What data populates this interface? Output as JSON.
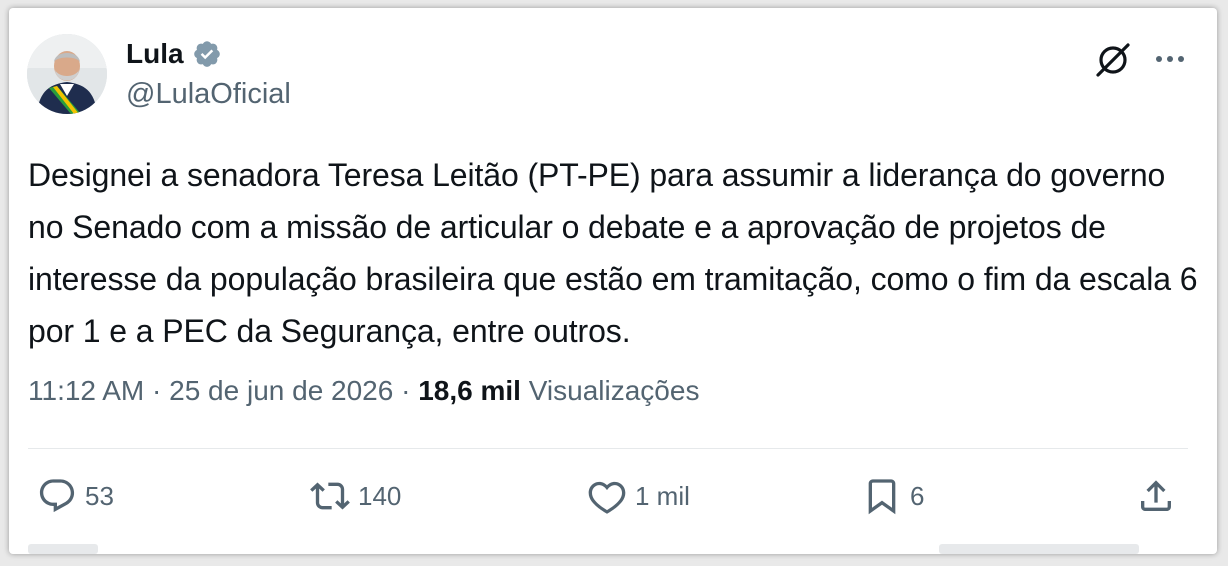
{
  "author": {
    "name": "Lula",
    "handle": "@LulaOficial"
  },
  "tweet": {
    "text": "Designei a senadora Teresa Leitão (PT-PE) para assumir a liderança do governo no Senado com a missão de articular o debate e a aprovação de projetos de interesse da população brasileira que estão em tramitação, como o fim da escala 6 por 1 e a PEC da Segurança, entre outros."
  },
  "meta": {
    "time": "11:12 AM",
    "sep1": " · ",
    "date": "25 de jun de 2026",
    "sep2": " · ",
    "views_count": "18,6 mil",
    "views_label": " Visualizações"
  },
  "actions": {
    "replies": "53",
    "retweets": "140",
    "likes": "1 mil",
    "bookmarks": "6"
  },
  "colors": {
    "text": "#0f1419",
    "secondary": "#536471",
    "verified": "#829aab"
  },
  "icons": [
    "verified-badge-icon",
    "grok-icon",
    "more-icon",
    "reply-icon",
    "retweet-icon",
    "like-icon",
    "bookmark-icon",
    "share-icon"
  ]
}
